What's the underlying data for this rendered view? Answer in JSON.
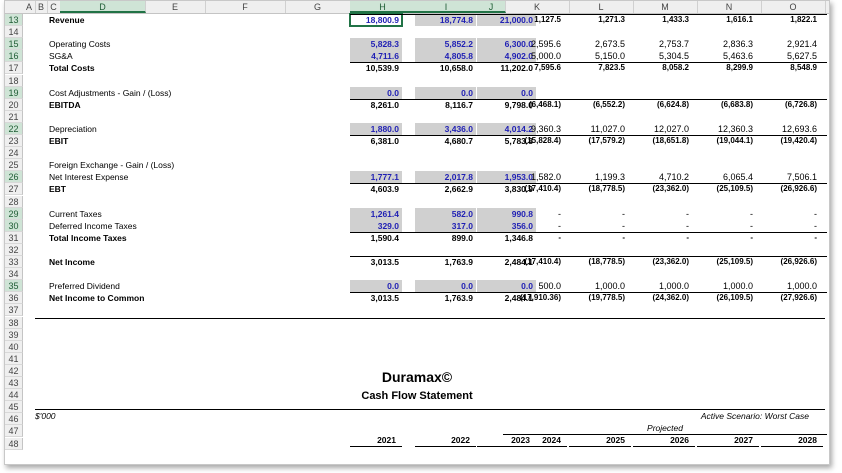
{
  "columns": [
    "A",
    "B",
    "C",
    "D",
    "E",
    "F",
    "G",
    "H",
    "I",
    "J",
    "K",
    "L",
    "M",
    "N",
    "O"
  ],
  "rows": [
    {
      "num": "13",
      "label": "Revenue",
      "bold": true,
      "sel": true,
      "hist": [
        "18,800.9",
        "18,774.8",
        "21,000.0"
      ],
      "proj": [
        "1,127.5",
        "1,271.3",
        "1,433.3",
        "1,616.1",
        "1,822.1"
      ],
      "blue": true
    },
    {
      "num": "14"
    },
    {
      "num": "15",
      "label": "Operating Costs",
      "sel": true,
      "hist": [
        "5,828.3",
        "5,852.2",
        "6,300.0"
      ],
      "proj": [
        "2,595.6",
        "2,673.5",
        "2,753.7",
        "2,836.3",
        "2,921.4"
      ],
      "blue": true
    },
    {
      "num": "16",
      "label": "SG&A",
      "sel": true,
      "hist": [
        "4,711.6",
        "4,805.8",
        "4,902.0"
      ],
      "proj": [
        "5,000.0",
        "5,150.0",
        "5,304.5",
        "5,463.6",
        "5,627.5"
      ],
      "blue": true
    },
    {
      "num": "17",
      "label": "Total Costs",
      "bold": true,
      "hist": [
        "10,539.9",
        "10,658.0",
        "11,202.0"
      ],
      "proj": [
        "7,595.6",
        "7,823.5",
        "8,058.2",
        "8,299.9",
        "8,548.9"
      ]
    },
    {
      "num": "18"
    },
    {
      "num": "19",
      "label": "Cost Adjustments - Gain / (Loss)",
      "sel": true,
      "hist": [
        "0.0",
        "0.0",
        "0.0"
      ],
      "proj": [
        "",
        "",
        "",
        "",
        ""
      ],
      "blue": true
    },
    {
      "num": "20",
      "label": "EBITDA",
      "bold": true,
      "hist": [
        "8,261.0",
        "8,116.7",
        "9,798.0"
      ],
      "proj": [
        "(6,468.1)",
        "(6,552.2)",
        "(6,624.8)",
        "(6,683.8)",
        "(6,726.8)"
      ]
    },
    {
      "num": "21"
    },
    {
      "num": "22",
      "label": "Depreciation",
      "sel": true,
      "hist": [
        "1,880.0",
        "3,436.0",
        "4,014.2"
      ],
      "proj": [
        "9,360.3",
        "11,027.0",
        "12,027.0",
        "12,360.3",
        "12,693.6"
      ],
      "blue": true
    },
    {
      "num": "23",
      "label": "EBIT",
      "bold": true,
      "hist": [
        "6,381.0",
        "4,680.7",
        "5,783.8"
      ],
      "proj": [
        "(15,828.4)",
        "(17,579.2)",
        "(18,651.8)",
        "(19,044.1)",
        "(19,420.4)"
      ]
    },
    {
      "num": "24"
    },
    {
      "num": "25",
      "label": "Foreign Exchange - Gain / (Loss)"
    },
    {
      "num": "26",
      "label": "Net Interest Expense",
      "sel": true,
      "hist": [
        "1,777.1",
        "2,017.8",
        "1,953.0"
      ],
      "proj": [
        "1,582.0",
        "1,199.3",
        "4,710.2",
        "6,065.4",
        "7,506.1"
      ],
      "blue": true
    },
    {
      "num": "27",
      "label": "EBT",
      "bold": true,
      "hist": [
        "4,603.9",
        "2,662.9",
        "3,830.9"
      ],
      "proj": [
        "(17,410.4)",
        "(18,778.5)",
        "(23,362.0)",
        "(25,109.5)",
        "(26,926.6)"
      ]
    },
    {
      "num": "28"
    },
    {
      "num": "29",
      "label": "Current Taxes",
      "sel": true,
      "hist": [
        "1,261.4",
        "582.0",
        "990.8"
      ],
      "proj": [
        "-",
        "-",
        "-",
        "-",
        "-"
      ],
      "blue": true
    },
    {
      "num": "30",
      "label": "Deferred Income Taxes",
      "sel": true,
      "hist": [
        "329.0",
        "317.0",
        "356.0"
      ],
      "proj": [
        "-",
        "-",
        "-",
        "-",
        "-"
      ],
      "blue": true
    },
    {
      "num": "31",
      "label": "Total Income Taxes",
      "bold": true,
      "hist": [
        "1,590.4",
        "899.0",
        "1,346.8"
      ],
      "proj": [
        "-",
        "-",
        "-",
        "-",
        "-"
      ]
    },
    {
      "num": "32"
    },
    {
      "num": "33",
      "label": "Net Income",
      "bold": true,
      "hist": [
        "3,013.5",
        "1,763.9",
        "2,484.1"
      ],
      "proj": [
        "(17,410.4)",
        "(18,778.5)",
        "(23,362.0)",
        "(25,109.5)",
        "(26,926.6)"
      ]
    },
    {
      "num": "34"
    },
    {
      "num": "35",
      "label": "Preferred Dividend",
      "sel": true,
      "hist": [
        "0.0",
        "0.0",
        "0.0"
      ],
      "proj": [
        "500.0",
        "1,000.0",
        "1,000.0",
        "1,000.0",
        "1,000.0"
      ],
      "blue": true
    },
    {
      "num": "36",
      "label": "Net Income to Common",
      "bold": true,
      "hist": [
        "3,013.5",
        "1,763.9",
        "2,484.1"
      ],
      "proj": [
        "(17,910.36)",
        "(19,778.5)",
        "(24,362.0)",
        "(26,109.5)",
        "(27,926.6)"
      ]
    },
    {
      "num": "37"
    },
    {
      "num": "38"
    },
    {
      "num": "39"
    },
    {
      "num": "40"
    },
    {
      "num": "41"
    },
    {
      "num": "42"
    },
    {
      "num": "43"
    },
    {
      "num": "44"
    },
    {
      "num": "45"
    },
    {
      "num": "46"
    },
    {
      "num": "47"
    },
    {
      "num": "48"
    }
  ],
  "header": {
    "company": "Duramax©",
    "statement": "Cash Flow Statement",
    "units": "$'000",
    "scenario": "Active Scenario: Worst Case",
    "projected": "Projected",
    "years": [
      "2021",
      "2022",
      "2023",
      "2024",
      "2025",
      "2026",
      "2027",
      "2028"
    ]
  }
}
